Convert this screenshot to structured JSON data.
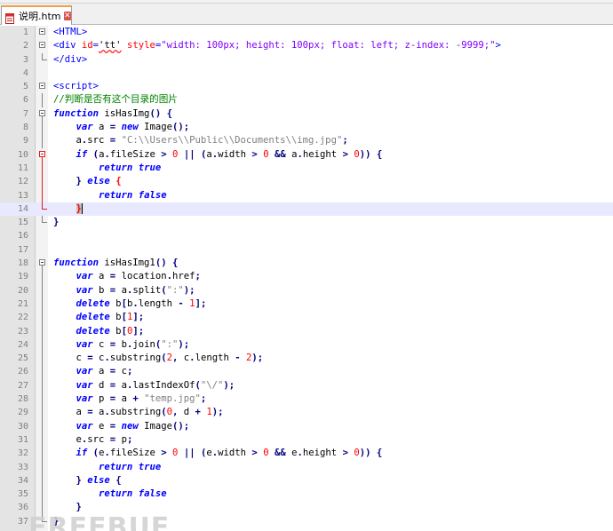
{
  "tab": {
    "title": "说明.htm"
  },
  "editor": {
    "lines": [
      {
        "n": "1",
        "segs": [
          [
            "tag",
            "<HTML>"
          ]
        ]
      },
      {
        "n": "2",
        "segs": [
          [
            "tag",
            "<div "
          ],
          [
            "attr",
            "id"
          ],
          [
            "tag",
            "="
          ],
          [
            "und",
            "'tt'"
          ],
          [
            "tag",
            " "
          ],
          [
            "attr",
            "style"
          ],
          [
            "tag",
            "="
          ],
          [
            "str",
            "\"width: 100px; height: 100px; float: left; z-index: -9999;\""
          ],
          [
            "tag",
            ">"
          ]
        ]
      },
      {
        "n": "3",
        "segs": [
          [
            "tag",
            "</div>"
          ]
        ]
      },
      {
        "n": "4",
        "segs": []
      },
      {
        "n": "5",
        "segs": [
          [
            "tag",
            "<script>"
          ]
        ]
      },
      {
        "n": "6",
        "segs": [
          [
            "cm",
            "//判断是否有这个目录的图片"
          ]
        ]
      },
      {
        "n": "7",
        "segs": [
          [
            "kw",
            "function"
          ],
          [
            "p",
            " isHasImg"
          ],
          [
            "op",
            "()"
          ],
          [
            "p",
            " "
          ],
          [
            "op",
            "{"
          ]
        ]
      },
      {
        "n": "8",
        "segs": [
          [
            "p",
            "    "
          ],
          [
            "kw",
            "var"
          ],
          [
            "p",
            " a "
          ],
          [
            "op",
            "="
          ],
          [
            "p",
            " "
          ],
          [
            "kw",
            "new"
          ],
          [
            "p",
            " Image"
          ],
          [
            "op",
            "();"
          ]
        ]
      },
      {
        "n": "9",
        "segs": [
          [
            "p",
            "    a"
          ],
          [
            "op",
            "."
          ],
          [
            "p",
            "src "
          ],
          [
            "op",
            "="
          ],
          [
            "p",
            " "
          ],
          [
            "jstr",
            "\"C:\\\\Users\\\\Public\\\\Documents\\\\img.jpg\""
          ],
          [
            "op",
            ";"
          ]
        ]
      },
      {
        "n": "10",
        "segs": [
          [
            "p",
            "    "
          ],
          [
            "kw",
            "if"
          ],
          [
            "p",
            " "
          ],
          [
            "op",
            "("
          ],
          [
            "p",
            "a"
          ],
          [
            "op",
            "."
          ],
          [
            "p",
            "fileSize "
          ],
          [
            "op",
            ">"
          ],
          [
            "p",
            " "
          ],
          [
            "num",
            "0"
          ],
          [
            "p",
            " "
          ],
          [
            "op",
            "||"
          ],
          [
            "p",
            " "
          ],
          [
            "op",
            "("
          ],
          [
            "p",
            "a"
          ],
          [
            "op",
            "."
          ],
          [
            "p",
            "width "
          ],
          [
            "op",
            ">"
          ],
          [
            "p",
            " "
          ],
          [
            "num",
            "0"
          ],
          [
            "p",
            " "
          ],
          [
            "op",
            "&&"
          ],
          [
            "p",
            " a"
          ],
          [
            "op",
            "."
          ],
          [
            "p",
            "height "
          ],
          [
            "op",
            ">"
          ],
          [
            "p",
            " "
          ],
          [
            "num",
            "0"
          ],
          [
            "op",
            "))"
          ],
          [
            "p",
            " "
          ],
          [
            "op",
            "{"
          ]
        ]
      },
      {
        "n": "11",
        "segs": [
          [
            "p",
            "        "
          ],
          [
            "kw",
            "return"
          ],
          [
            "p",
            " "
          ],
          [
            "kw",
            "true"
          ]
        ]
      },
      {
        "n": "12",
        "segs": [
          [
            "p",
            "    "
          ],
          [
            "op",
            "}"
          ],
          [
            "p",
            " "
          ],
          [
            "kw",
            "else"
          ],
          [
            "p",
            " "
          ],
          [
            "redop",
            "{"
          ]
        ]
      },
      {
        "n": "13",
        "segs": [
          [
            "p",
            "        "
          ],
          [
            "kw",
            "return"
          ],
          [
            "p",
            " "
          ],
          [
            "kw",
            "false"
          ]
        ]
      },
      {
        "n": "14",
        "segs": [
          [
            "p",
            "    "
          ],
          [
            "brace",
            "}"
          ],
          [
            "caret",
            ""
          ]
        ]
      },
      {
        "n": "15",
        "segs": [
          [
            "op",
            "}"
          ]
        ]
      },
      {
        "n": "16",
        "segs": []
      },
      {
        "n": "17",
        "segs": []
      },
      {
        "n": "18",
        "segs": [
          [
            "kw",
            "function"
          ],
          [
            "p",
            " isHasImg1"
          ],
          [
            "op",
            "()"
          ],
          [
            "p",
            " "
          ],
          [
            "op",
            "{"
          ]
        ]
      },
      {
        "n": "19",
        "segs": [
          [
            "p",
            "    "
          ],
          [
            "kw",
            "var"
          ],
          [
            "p",
            " a "
          ],
          [
            "op",
            "="
          ],
          [
            "p",
            " location"
          ],
          [
            "op",
            "."
          ],
          [
            "p",
            "href"
          ],
          [
            "op",
            ";"
          ]
        ]
      },
      {
        "n": "20",
        "segs": [
          [
            "p",
            "    "
          ],
          [
            "kw",
            "var"
          ],
          [
            "p",
            " b "
          ],
          [
            "op",
            "="
          ],
          [
            "p",
            " a"
          ],
          [
            "op",
            "."
          ],
          [
            "p",
            "split"
          ],
          [
            "op",
            "("
          ],
          [
            "jstr",
            "\":\""
          ],
          [
            "op",
            ");"
          ]
        ]
      },
      {
        "n": "21",
        "segs": [
          [
            "p",
            "    "
          ],
          [
            "kw",
            "delete"
          ],
          [
            "p",
            " b"
          ],
          [
            "op",
            "["
          ],
          [
            "p",
            "b"
          ],
          [
            "op",
            "."
          ],
          [
            "p",
            "length "
          ],
          [
            "op",
            "-"
          ],
          [
            "p",
            " "
          ],
          [
            "num",
            "1"
          ],
          [
            "op",
            "];"
          ]
        ]
      },
      {
        "n": "22",
        "segs": [
          [
            "p",
            "    "
          ],
          [
            "kw",
            "delete"
          ],
          [
            "p",
            " b"
          ],
          [
            "op",
            "["
          ],
          [
            "num",
            "1"
          ],
          [
            "op",
            "];"
          ]
        ]
      },
      {
        "n": "23",
        "segs": [
          [
            "p",
            "    "
          ],
          [
            "kw",
            "delete"
          ],
          [
            "p",
            " b"
          ],
          [
            "op",
            "["
          ],
          [
            "num",
            "0"
          ],
          [
            "op",
            "];"
          ]
        ]
      },
      {
        "n": "24",
        "segs": [
          [
            "p",
            "    "
          ],
          [
            "kw",
            "var"
          ],
          [
            "p",
            " c "
          ],
          [
            "op",
            "="
          ],
          [
            "p",
            " b"
          ],
          [
            "op",
            "."
          ],
          [
            "p",
            "join"
          ],
          [
            "op",
            "("
          ],
          [
            "jstr",
            "\":\""
          ],
          [
            "op",
            ");"
          ]
        ]
      },
      {
        "n": "25",
        "segs": [
          [
            "p",
            "    c "
          ],
          [
            "op",
            "="
          ],
          [
            "p",
            " c"
          ],
          [
            "op",
            "."
          ],
          [
            "p",
            "substring"
          ],
          [
            "op",
            "("
          ],
          [
            "num",
            "2"
          ],
          [
            "op",
            ","
          ],
          [
            "p",
            " c"
          ],
          [
            "op",
            "."
          ],
          [
            "p",
            "length "
          ],
          [
            "op",
            "-"
          ],
          [
            "p",
            " "
          ],
          [
            "num",
            "2"
          ],
          [
            "op",
            ");"
          ]
        ]
      },
      {
        "n": "26",
        "segs": [
          [
            "p",
            "    "
          ],
          [
            "kw",
            "var"
          ],
          [
            "p",
            " a "
          ],
          [
            "op",
            "="
          ],
          [
            "p",
            " c"
          ],
          [
            "op",
            ";"
          ]
        ]
      },
      {
        "n": "27",
        "segs": [
          [
            "p",
            "    "
          ],
          [
            "kw",
            "var"
          ],
          [
            "p",
            " d "
          ],
          [
            "op",
            "="
          ],
          [
            "p",
            " a"
          ],
          [
            "op",
            "."
          ],
          [
            "p",
            "lastIndexOf"
          ],
          [
            "op",
            "("
          ],
          [
            "jstr",
            "\"\\/\""
          ],
          [
            "op",
            ");"
          ]
        ]
      },
      {
        "n": "28",
        "segs": [
          [
            "p",
            "    "
          ],
          [
            "kw",
            "var"
          ],
          [
            "p",
            " p "
          ],
          [
            "op",
            "="
          ],
          [
            "p",
            " a "
          ],
          [
            "op",
            "+"
          ],
          [
            "p",
            " "
          ],
          [
            "jstr",
            "\"temp.jpg\""
          ],
          [
            "op",
            ";"
          ]
        ]
      },
      {
        "n": "29",
        "segs": [
          [
            "p",
            "    a "
          ],
          [
            "op",
            "="
          ],
          [
            "p",
            " a"
          ],
          [
            "op",
            "."
          ],
          [
            "p",
            "substring"
          ],
          [
            "op",
            "("
          ],
          [
            "num",
            "0"
          ],
          [
            "op",
            ","
          ],
          [
            "p",
            " d "
          ],
          [
            "op",
            "+"
          ],
          [
            "p",
            " "
          ],
          [
            "num",
            "1"
          ],
          [
            "op",
            ");"
          ]
        ]
      },
      {
        "n": "30",
        "segs": [
          [
            "p",
            "    "
          ],
          [
            "kw",
            "var"
          ],
          [
            "p",
            " e "
          ],
          [
            "op",
            "="
          ],
          [
            "p",
            " "
          ],
          [
            "kw",
            "new"
          ],
          [
            "p",
            " Image"
          ],
          [
            "op",
            "();"
          ]
        ]
      },
      {
        "n": "31",
        "segs": [
          [
            "p",
            "    e"
          ],
          [
            "op",
            "."
          ],
          [
            "p",
            "src "
          ],
          [
            "op",
            "="
          ],
          [
            "p",
            " p"
          ],
          [
            "op",
            ";"
          ]
        ]
      },
      {
        "n": "32",
        "segs": [
          [
            "p",
            "    "
          ],
          [
            "kw",
            "if"
          ],
          [
            "p",
            " "
          ],
          [
            "op",
            "("
          ],
          [
            "p",
            "e"
          ],
          [
            "op",
            "."
          ],
          [
            "p",
            "fileSize "
          ],
          [
            "op",
            ">"
          ],
          [
            "p",
            " "
          ],
          [
            "num",
            "0"
          ],
          [
            "p",
            " "
          ],
          [
            "op",
            "||"
          ],
          [
            "p",
            " "
          ],
          [
            "op",
            "("
          ],
          [
            "p",
            "e"
          ],
          [
            "op",
            "."
          ],
          [
            "p",
            "width "
          ],
          [
            "op",
            ">"
          ],
          [
            "p",
            " "
          ],
          [
            "num",
            "0"
          ],
          [
            "p",
            " "
          ],
          [
            "op",
            "&&"
          ],
          [
            "p",
            " e"
          ],
          [
            "op",
            "."
          ],
          [
            "p",
            "height "
          ],
          [
            "op",
            ">"
          ],
          [
            "p",
            " "
          ],
          [
            "num",
            "0"
          ],
          [
            "op",
            "))"
          ],
          [
            "p",
            " "
          ],
          [
            "op",
            "{"
          ]
        ]
      },
      {
        "n": "33",
        "segs": [
          [
            "p",
            "        "
          ],
          [
            "kw",
            "return"
          ],
          [
            "p",
            " "
          ],
          [
            "kw",
            "true"
          ]
        ]
      },
      {
        "n": "34",
        "segs": [
          [
            "p",
            "    "
          ],
          [
            "op",
            "}"
          ],
          [
            "p",
            " "
          ],
          [
            "kw",
            "else"
          ],
          [
            "p",
            " "
          ],
          [
            "op",
            "{"
          ]
        ]
      },
      {
        "n": "35",
        "segs": [
          [
            "p",
            "        "
          ],
          [
            "kw",
            "return"
          ],
          [
            "p",
            " "
          ],
          [
            "kw",
            "false"
          ]
        ]
      },
      {
        "n": "36",
        "segs": [
          [
            "p",
            "    "
          ],
          [
            "op",
            "}"
          ]
        ]
      },
      {
        "n": "37",
        "segs": [
          [
            "op",
            "}"
          ]
        ]
      }
    ]
  },
  "watermark": "FREEBUF"
}
